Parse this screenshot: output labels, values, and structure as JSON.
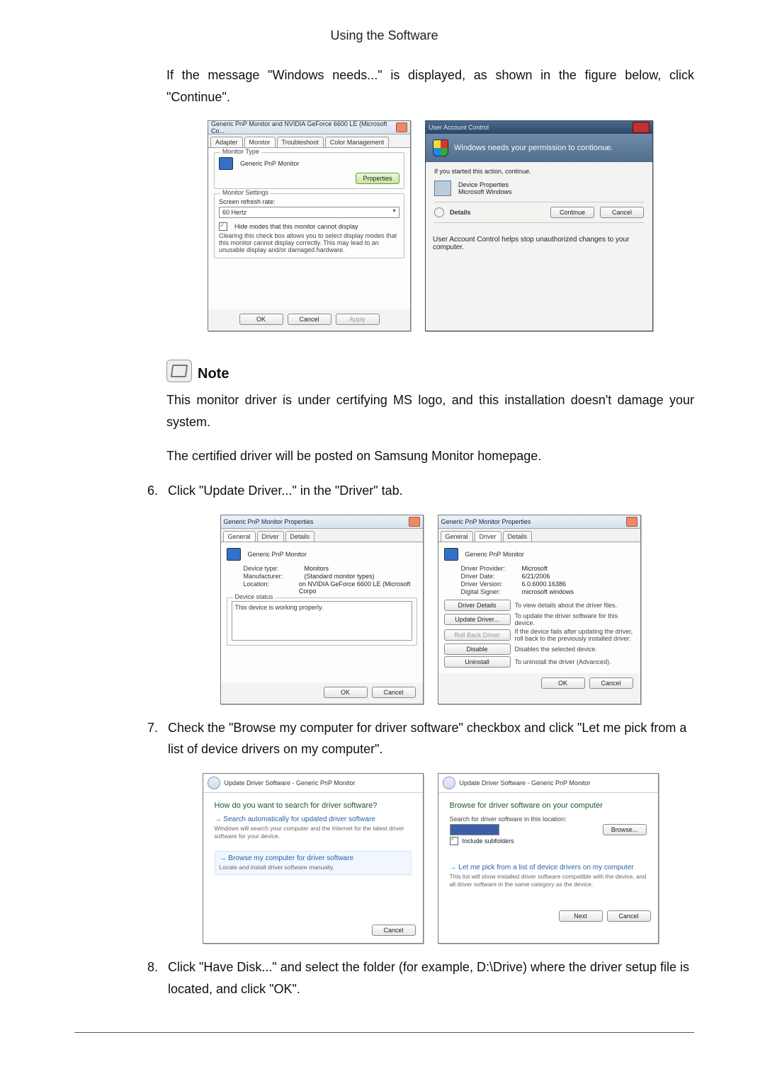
{
  "header": {
    "title": "Using the Software"
  },
  "intro": "If the message \"Windows needs...\" is displayed, as shown in the figure below, click \"Continue\".",
  "shot1": {
    "monitor_props": {
      "window_title": "Generic PnP Monitor and NVIDIA GeForce 6600 LE (Microsoft Co...",
      "tabs": [
        "Adapter",
        "Monitor",
        "Troubleshoot",
        "Color Management"
      ],
      "monitor_type_legend": "Monitor Type",
      "monitor_name": "Generic PnP Monitor",
      "properties_btn": "Properties",
      "settings_legend": "Monitor Settings",
      "refresh_label": "Screen refresh rate:",
      "refresh_value": "60 Hertz",
      "hide_modes": "Hide modes that this monitor cannot display",
      "hide_help": "Clearing this check box allows you to select display modes that this monitor cannot display correctly. This may lead to an unusable display and/or damaged hardware.",
      "ok": "OK",
      "cancel": "Cancel",
      "apply": "Apply"
    },
    "uac": {
      "title": "User Account Control",
      "band": "Windows needs your permission to contionue.",
      "started": "If you started this action, continue.",
      "app1": "Device Properties",
      "app2": "Microsoft Windows",
      "details": "Details",
      "continue": "Continue",
      "cancel": "Cancel",
      "footer": "User Account Control helps stop unauthorized changes to your computer."
    }
  },
  "note": {
    "label": "Note",
    "line1": "This monitor driver is under certifying MS logo, and this installation doesn't damage your system.",
    "line2": "The certified driver will be posted on Samsung Monitor homepage."
  },
  "steps": {
    "s6": "Click \"Update Driver...\" in the \"Driver\" tab.",
    "s7": "Check the \"Browse my computer for driver software\" checkbox and click \"Let me pick from a list of device drivers on my computer\".",
    "s8": "Click \"Have Disk...\" and select the folder (for example, D:\\Drive) where the driver setup file is located, and click \"OK\"."
  },
  "shot2": {
    "left": {
      "title": "Generic PnP Monitor Properties",
      "tabs": [
        "General",
        "Driver",
        "Details"
      ],
      "name": "Generic PnP Monitor",
      "dev_type_k": "Device type:",
      "dev_type_v": "Monitors",
      "mfr_k": "Manufacturer:",
      "mfr_v": "(Standard monitor types)",
      "loc_k": "Location:",
      "loc_v": "on NVIDIA GeForce 6600 LE (Microsoft Corpo",
      "status_legend": "Device status",
      "status_text": "This device is working properly.",
      "ok": "OK",
      "cancel": "Cancel"
    },
    "right": {
      "title": "Generic PnP Monitor Properties",
      "tabs": [
        "General",
        "Driver",
        "Details"
      ],
      "name": "Generic PnP Monitor",
      "provider_k": "Driver Provider:",
      "provider_v": "Microsoft",
      "date_k": "Driver Date:",
      "date_v": "6/21/2006",
      "version_k": "Driver Version:",
      "version_v": "6.0.6000.16386",
      "signer_k": "Digital Signer:",
      "signer_v": "microsoft windows",
      "btn_details": "Driver Details",
      "btn_details_d": "To view details about the driver files.",
      "btn_update": "Update Driver...",
      "btn_update_d": "To update the driver software for this device.",
      "btn_rollback": "Roll Back Driver",
      "btn_rollback_d": "If the device fails after updating the driver, roll back to the previously installed driver.",
      "btn_disable": "Disable",
      "btn_disable_d": "Disables the selected device.",
      "btn_uninstall": "Uninstall",
      "btn_uninstall_d": "To uninstall the driver (Advanced).",
      "ok": "OK",
      "cancel": "Cancel"
    }
  },
  "shot3": {
    "left": {
      "crumb": "Update Driver Software - Generic PnP Monitor",
      "heading": "How do you want to search for driver software?",
      "opt1_title": "Search automatically for updated driver software",
      "opt1_sub": "Windows will search your computer and the Internet for the latest driver software for your device.",
      "opt2_title": "Browse my computer for driver software",
      "opt2_sub": "Locate and install driver software manually.",
      "cancel": "Cancel"
    },
    "right": {
      "crumb": "Update Driver Software - Generic PnP Monitor",
      "heading": "Browse for driver software on your computer",
      "search_label": "Search for driver software in this location:",
      "browse": "Browse...",
      "include": "Include subfolders",
      "opt_title": "Let me pick from a list of device drivers on my computer",
      "opt_sub": "This list will show installed driver software compatible with the device, and all driver software in the same category as the device.",
      "next": "Next",
      "cancel": "Cancel"
    }
  }
}
